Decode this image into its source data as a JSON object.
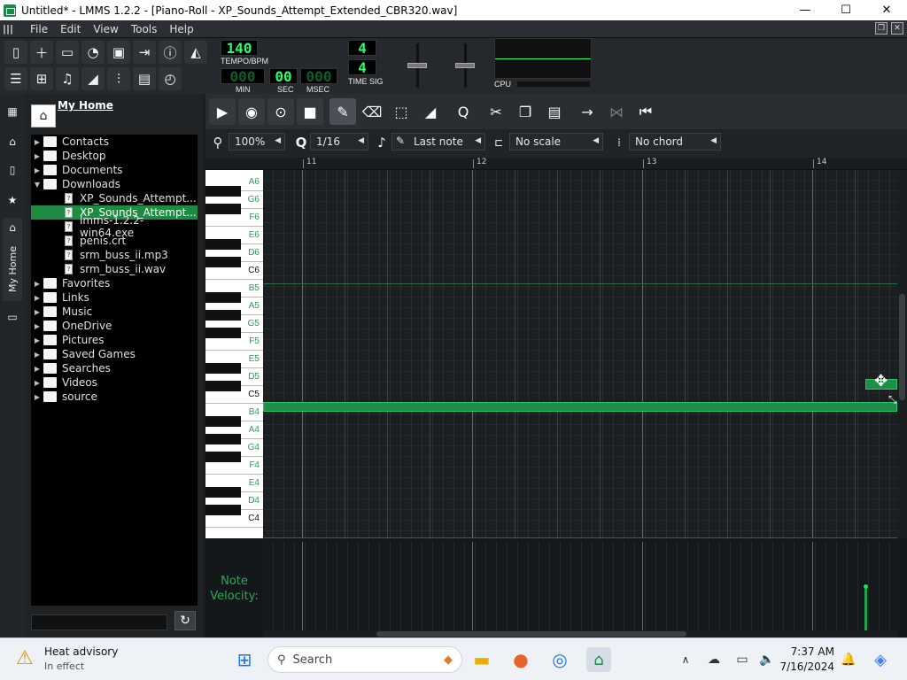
{
  "window": {
    "title": "Untitled* - LMMS 1.2.2 - [Piano-Roll - XP_Sounds_Attempt_Extended_CBR320.wav]",
    "minimize": "—",
    "maximize": "☐",
    "close": "✕"
  },
  "menu": {
    "items": [
      "File",
      "Edit",
      "View",
      "Tools",
      "Help"
    ]
  },
  "transport_display": {
    "tempo": "140",
    "tempo_label": "TEMPO/BPM",
    "min": "000",
    "sec": "00",
    "msec": "000",
    "min_label": "MIN",
    "sec_label": "SEC",
    "msec_label": "MSEC",
    "timesig_num": "4",
    "timesig_den": "4",
    "timesig_label": "TIME SIG",
    "cpu_label": "CPU"
  },
  "file_browser": {
    "title": "My Home",
    "side_tab_label": "My Home",
    "items": [
      {
        "label": "Contacts",
        "type": "folder",
        "expanded": false,
        "depth": 0
      },
      {
        "label": "Desktop",
        "type": "folder",
        "expanded": false,
        "depth": 0
      },
      {
        "label": "Documents",
        "type": "folder",
        "expanded": false,
        "depth": 0
      },
      {
        "label": "Downloads",
        "type": "folder",
        "expanded": true,
        "depth": 0
      },
      {
        "label": "XP_Sounds_Attempt...",
        "type": "file",
        "depth": 1
      },
      {
        "label": "XP_Sounds_Attempt...",
        "type": "file",
        "depth": 1,
        "selected": true
      },
      {
        "label": "lmms-1.2.2-win64.exe",
        "type": "file",
        "depth": 1
      },
      {
        "label": "penis.crt",
        "type": "file",
        "depth": 1
      },
      {
        "label": "srm_buss_ii.mp3",
        "type": "file",
        "depth": 1
      },
      {
        "label": "srm_buss_ii.wav",
        "type": "file",
        "depth": 1
      },
      {
        "label": "Favorites",
        "type": "folder",
        "expanded": false,
        "depth": 0
      },
      {
        "label": "Links",
        "type": "folder",
        "expanded": false,
        "depth": 0
      },
      {
        "label": "Music",
        "type": "folder",
        "expanded": false,
        "depth": 0
      },
      {
        "label": "OneDrive",
        "type": "folder",
        "expanded": false,
        "depth": 0
      },
      {
        "label": "Pictures",
        "type": "folder",
        "expanded": false,
        "depth": 0
      },
      {
        "label": "Saved Games",
        "type": "folder",
        "expanded": false,
        "depth": 0
      },
      {
        "label": "Searches",
        "type": "folder",
        "expanded": false,
        "depth": 0
      },
      {
        "label": "Videos",
        "type": "folder",
        "expanded": false,
        "depth": 0
      },
      {
        "label": "source",
        "type": "folder",
        "expanded": false,
        "depth": 0
      }
    ]
  },
  "piano_roll": {
    "zoom": "100%",
    "quantize": "1/16",
    "note_length": "Last note",
    "scale": "No scale",
    "chord": "No chord",
    "bars": [
      "11",
      "12",
      "13",
      "14"
    ],
    "keys": [
      "A6",
      "G6",
      "F6",
      "E6",
      "D6",
      "C6",
      "B5",
      "A5",
      "G5",
      "F5",
      "E5",
      "D5",
      "C5",
      "B4",
      "A4",
      "G4",
      "F4",
      "E4",
      "D4",
      "C4"
    ],
    "velocity_label_1": "Note",
    "velocity_label_2": "Velocity:",
    "accent_color": "#1e8e4a"
  },
  "taskbar": {
    "weather_title": "Heat advisory",
    "weather_sub": "In effect",
    "search_placeholder": "Search",
    "time": "7:37 AM",
    "date": "7/16/2024"
  }
}
